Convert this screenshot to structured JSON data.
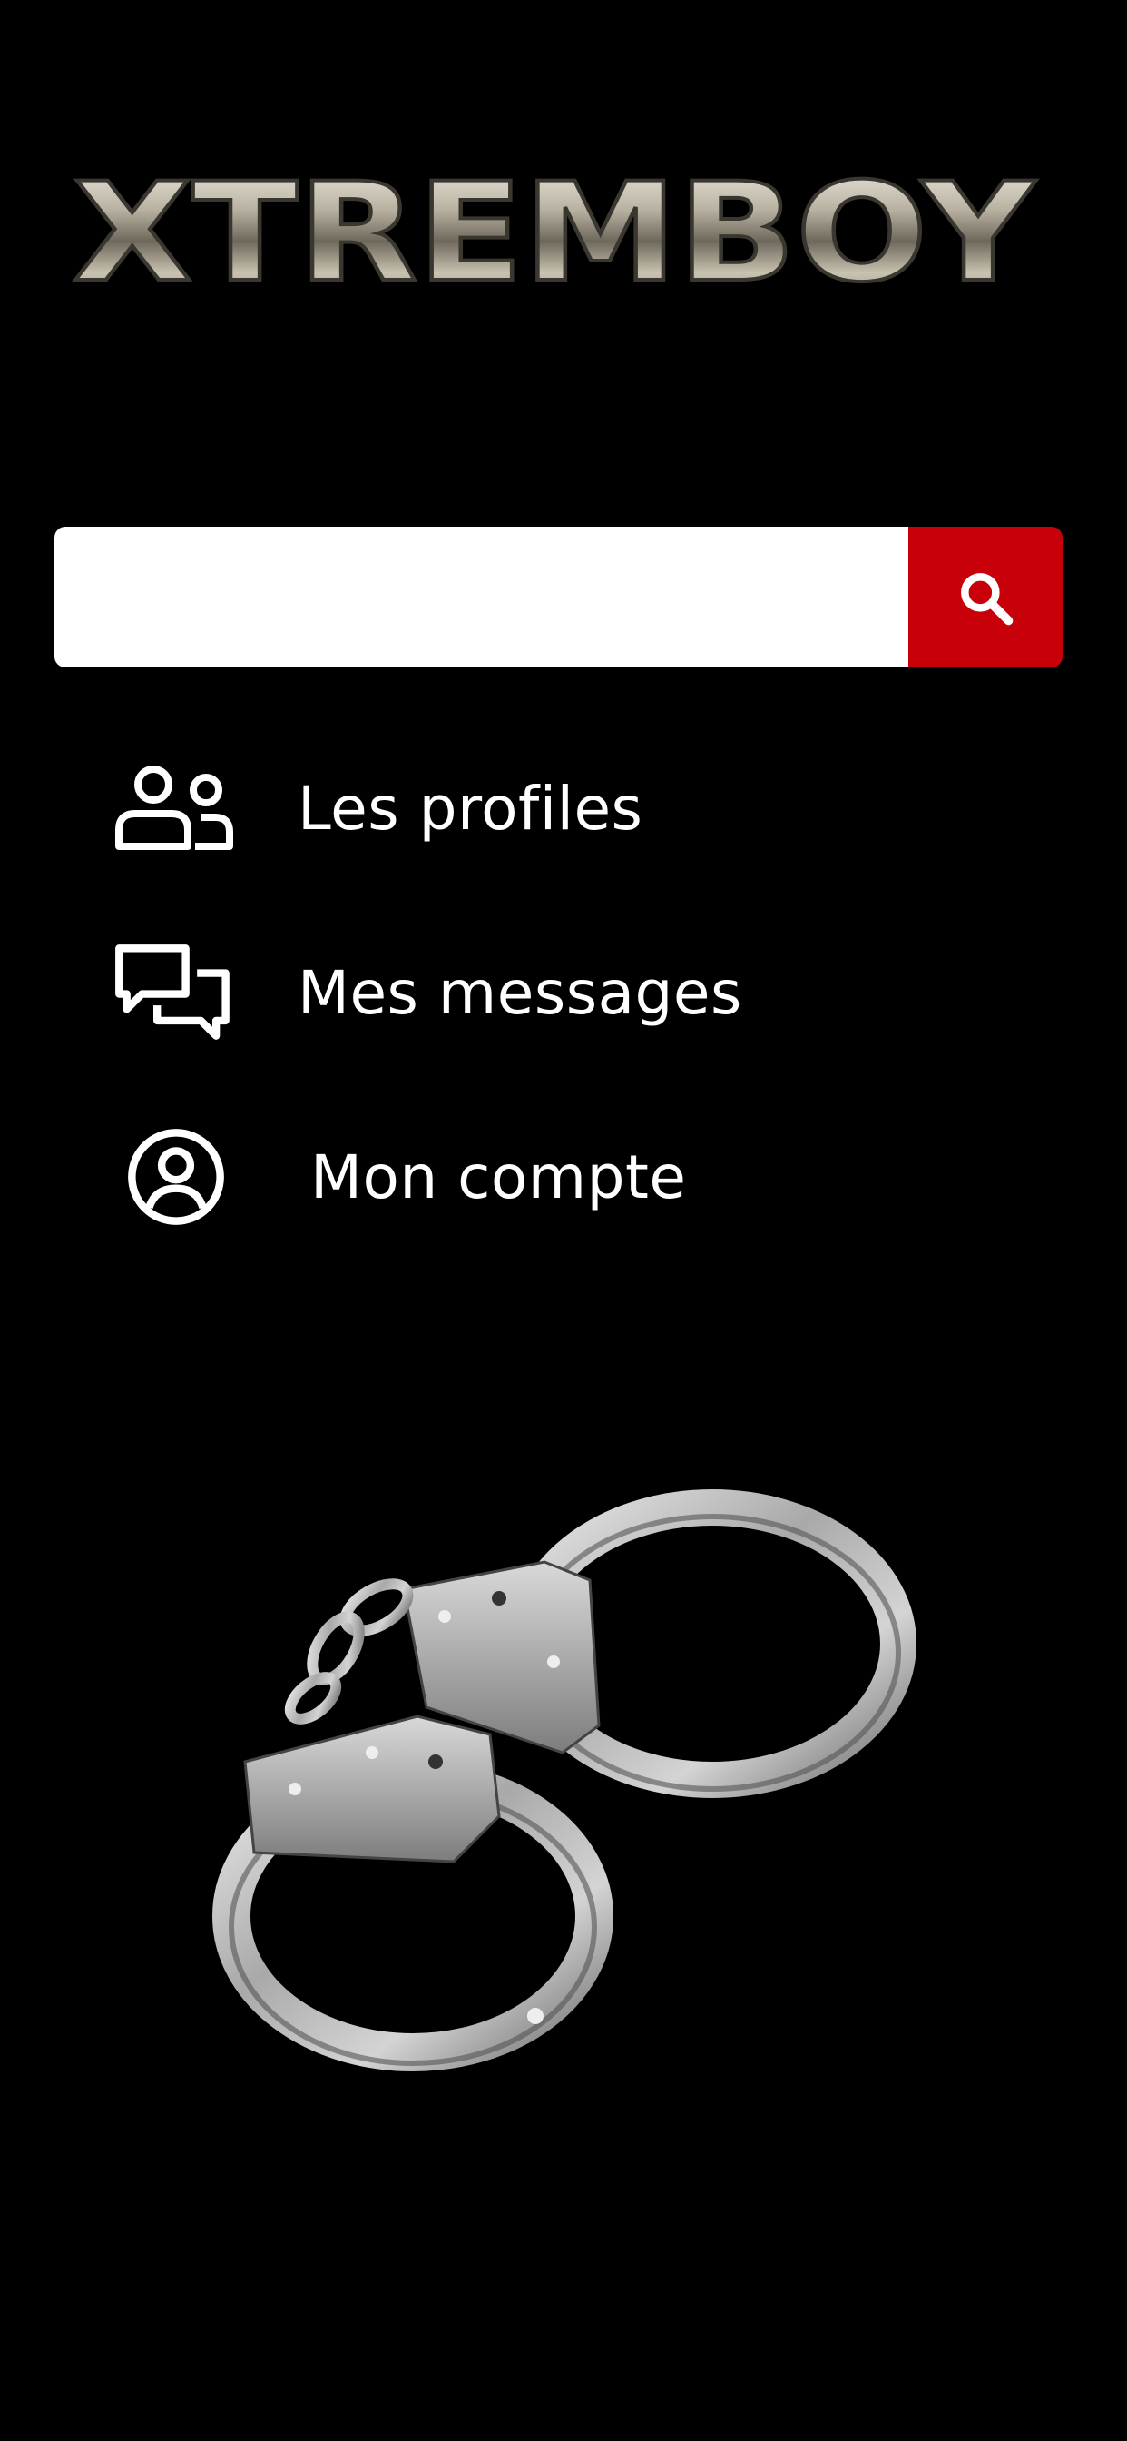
{
  "app": {
    "logo_text": "XTREMBOY"
  },
  "search": {
    "value": "",
    "placeholder": "",
    "button_icon": "search-icon",
    "button_color": "#c8000a"
  },
  "menu": {
    "items": [
      {
        "label": "Les profiles",
        "icon": "users-icon"
      },
      {
        "label": "Mes messages",
        "icon": "chat-bubbles-icon"
      },
      {
        "label": "Mon compte",
        "icon": "user-circle-icon"
      }
    ]
  },
  "hero": {
    "image": "handcuffs"
  },
  "colors": {
    "background": "#000000",
    "accent": "#c8000a",
    "text": "#ffffff"
  }
}
